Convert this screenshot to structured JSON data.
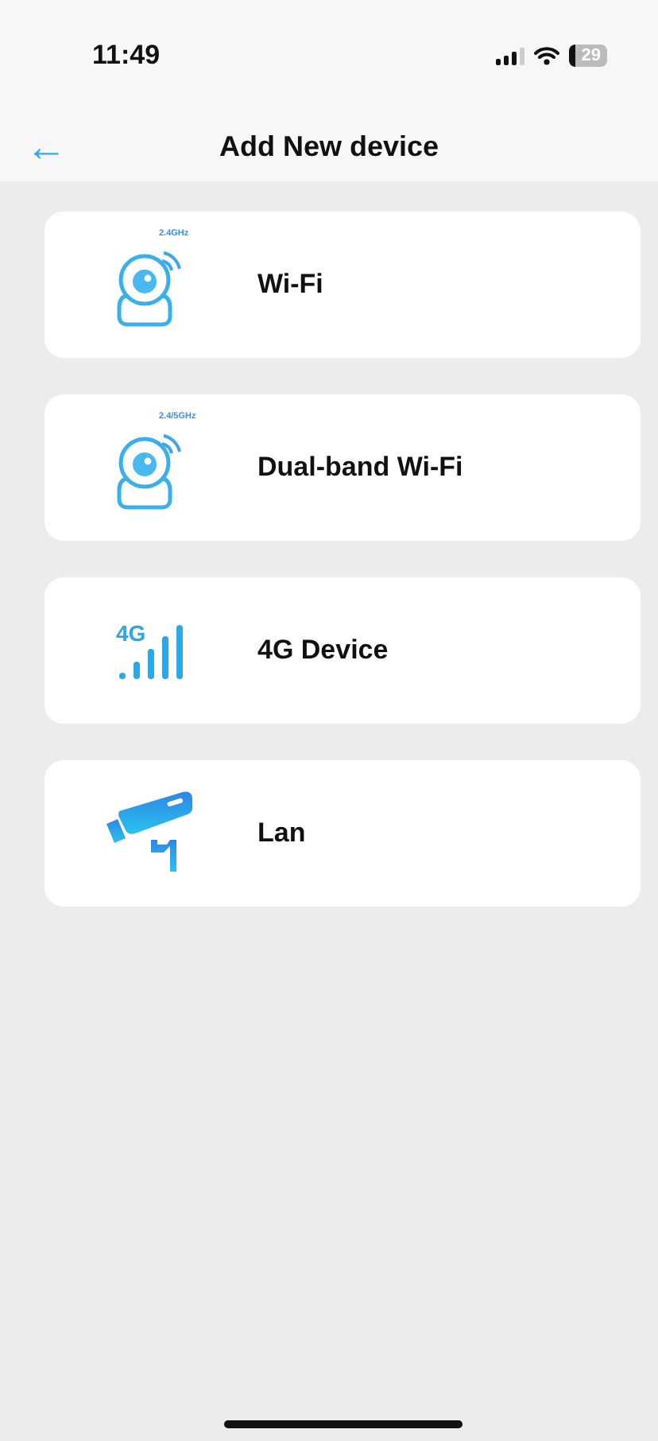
{
  "status_bar": {
    "time": "11:49",
    "battery": "29"
  },
  "header": {
    "back": "←",
    "title": "Add New device"
  },
  "devices": [
    {
      "kind": "camera",
      "tag": "2.4GHz",
      "label": "Wi-Fi"
    },
    {
      "kind": "camera",
      "tag": "2.4/5GHz",
      "label": "Dual-band Wi-Fi"
    },
    {
      "kind": "cellular",
      "tag": "4G",
      "label": "4G Device"
    },
    {
      "kind": "bullet",
      "label": "Lan"
    }
  ]
}
